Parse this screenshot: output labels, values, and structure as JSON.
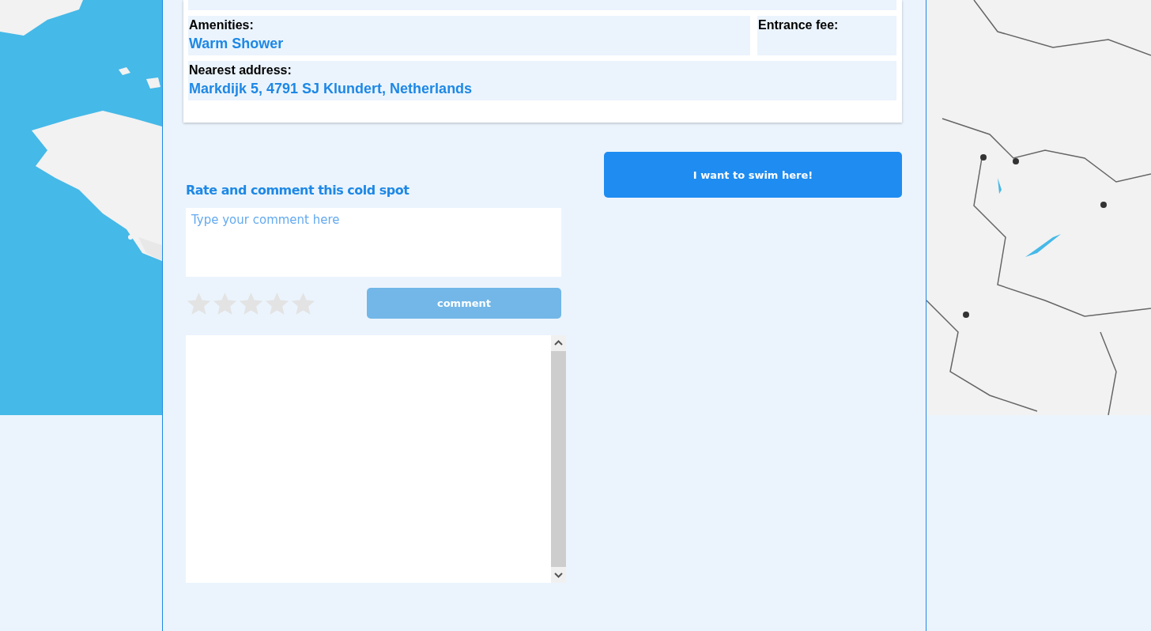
{
  "details": {
    "fields": [
      {
        "label": "Amenities:",
        "value": "Warm Shower"
      },
      {
        "label": "Entrance fee:"
      },
      {
        "label": "Nearest address:",
        "value": "Markdijk 5, 4791 SJ Klundert, Netherlands"
      }
    ]
  },
  "swim_button": "I want to swim here!",
  "review": {
    "heading": "Rate and comment this cold spot",
    "comment_field": {
      "placeholder": "Type your comment here"
    },
    "stars": 0,
    "submit_button": "comment"
  }
}
